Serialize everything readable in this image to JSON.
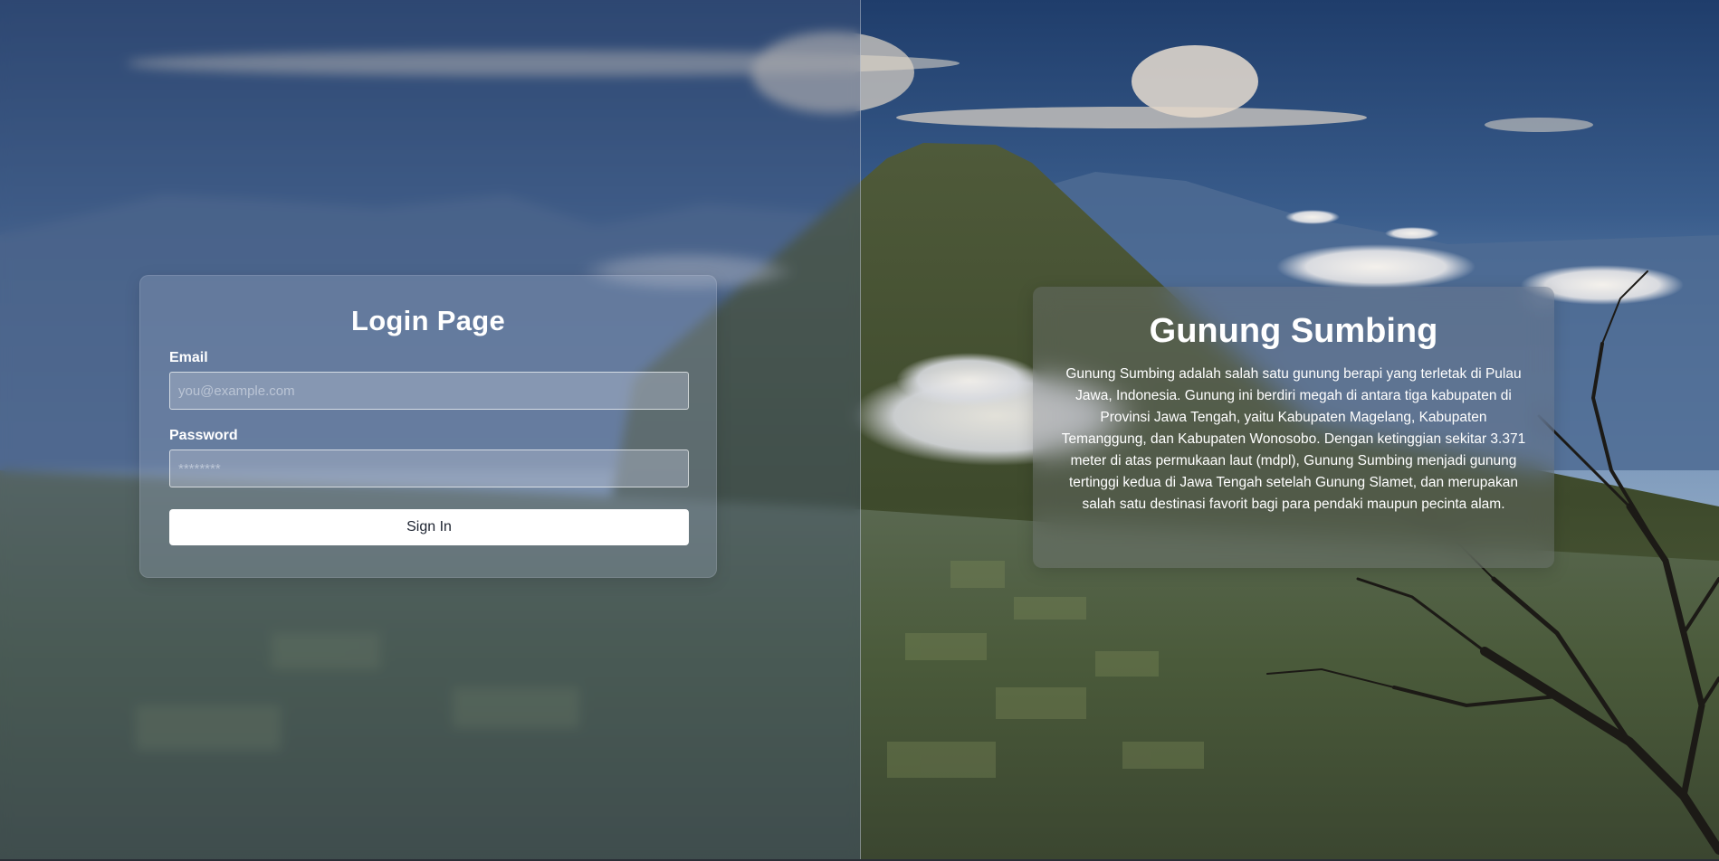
{
  "login": {
    "title": "Login Page",
    "email_label": "Email",
    "email_placeholder": "you@example.com",
    "email_value": "",
    "password_label": "Password",
    "password_placeholder": "********",
    "password_value": "",
    "submit_label": "Sign In"
  },
  "info": {
    "title": "Gunung Sumbing",
    "description": "Gunung Sumbing adalah salah satu gunung berapi yang terletak di Pulau Jawa, Indonesia. Gunung ini berdiri megah di antara tiga kabupaten di Provinsi Jawa Tengah, yaitu Kabupaten Magelang, Kabupaten Temanggung, dan Kabupaten Wonosobo. Dengan ketinggian sekitar 3.371 meter di atas permukaan laut (mdpl), Gunung Sumbing menjadi gunung tertinggi kedua di Jawa Tengah setelah Gunung Slamet, dan merupakan salah satu destinasi favorit bagi para pendaki maupun pecinta alam."
  },
  "background": {
    "subject": "mountain-landscape",
    "sky_color": "#2f4f7a",
    "accent_color": "#ffffff"
  }
}
